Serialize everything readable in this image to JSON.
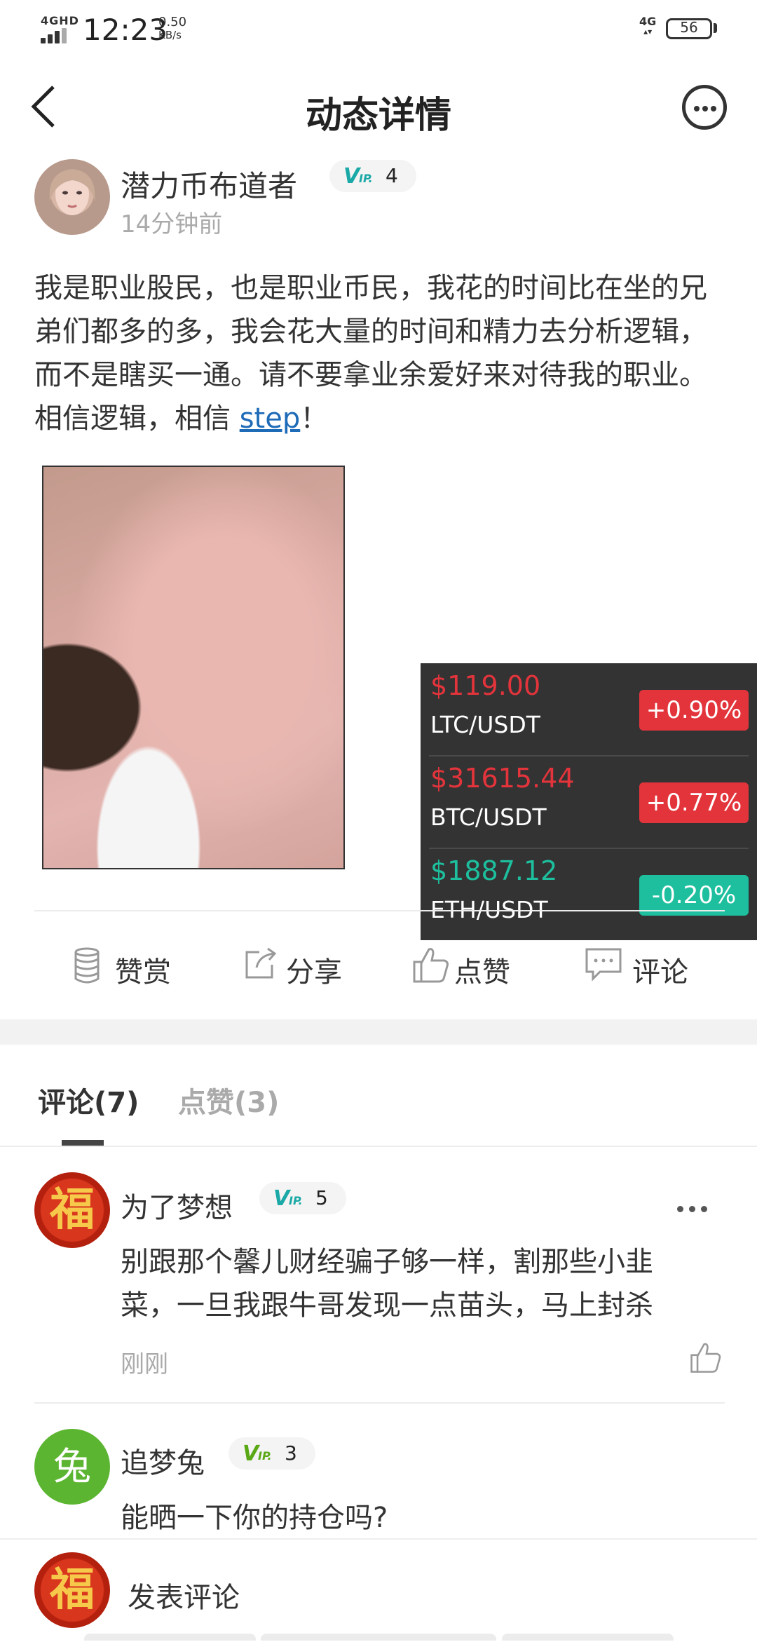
{
  "status_bar": {
    "network_left": "4GHD",
    "time": "12:23",
    "speed_value": "0.50",
    "speed_unit": "KB/s",
    "network_right": "4G",
    "battery": "56"
  },
  "header": {
    "title": "动态详情"
  },
  "post": {
    "author": "潜力币布道者",
    "vip_level": "4",
    "time": "14分钟前",
    "text_before_link": "我是职业股民，也是职业币民，我花的时间比在坐的兄弟们都多的多，我会花大量的时间和精力去分析逻辑，而不是瞎买一通。请不要拿业余爱好来对待我的职业。相信逻辑，相信 ",
    "link_text": "step",
    "text_after_link": "！"
  },
  "ticker": [
    {
      "price": "$119.00",
      "pair": "LTC/USDT",
      "change": "+0.90%",
      "direction": "up"
    },
    {
      "price": "$31615.44",
      "pair": "BTC/USDT",
      "change": "+0.77%",
      "direction": "up"
    },
    {
      "price": "$1887.12",
      "pair": "ETH/USDT",
      "change": "-0.20%",
      "direction": "down"
    }
  ],
  "actions": {
    "reward": "赞赏",
    "share": "分享",
    "like": "点赞",
    "comment": "评论"
  },
  "tabs": {
    "comments": "评论(7)",
    "likes": "点赞(3)"
  },
  "comments": [
    {
      "avatar_text": "福",
      "name": "为了梦想",
      "vip_level": "5",
      "text": "别跟那个馨儿财经骗子够一样，割那些小韭菜，一旦我跟牛哥发现一点苗头，马上封杀",
      "time": "刚刚"
    },
    {
      "avatar_text": "兔",
      "name": "追梦兔",
      "vip_level": "3",
      "text": "能晒一下你的持仓吗?"
    }
  ],
  "bottom": {
    "avatar_text": "福",
    "placeholder": "发表评论"
  },
  "vip": {
    "v": "V",
    "ip": "IP."
  },
  "colors": {
    "up": "#e3343c",
    "down": "#1dbf9e",
    "vip_teal": "#1aa9a6",
    "vip_green": "#5aa815",
    "link": "#1e6bb8"
  }
}
